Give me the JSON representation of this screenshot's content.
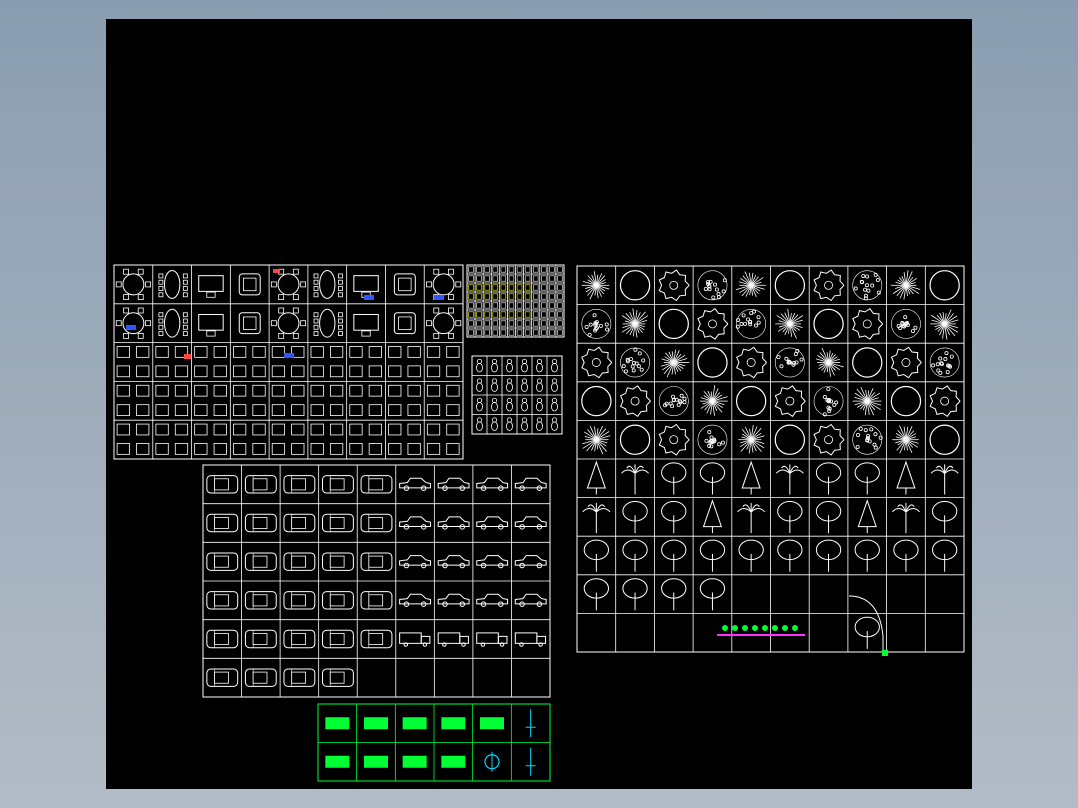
{
  "app": {
    "window_title": "",
    "background_color": "#000000"
  },
  "colors": {
    "line": "#ffffff",
    "accent_green": "#00ff33",
    "accent_yellow": "#ffff00",
    "accent_cyan": "#00d8ff",
    "accent_red": "#ff4444",
    "accent_blue": "#3355ff",
    "accent_magenta": "#ff33ff"
  },
  "sheets": [
    {
      "id": "furniture-sheet",
      "content": "furniture-blocks",
      "cols": 9,
      "rows": 5
    },
    {
      "id": "symbol-sheet-small",
      "content": "small-symbols",
      "cols": 12,
      "rows": 8
    },
    {
      "id": "people-sheet",
      "content": "people-blocks",
      "cols": 6,
      "rows": 4
    },
    {
      "id": "vehicle-sheet",
      "content": "vehicle-blocks",
      "cols": 9,
      "rows": 6
    },
    {
      "id": "sign-sheet",
      "content": "sign-blocks",
      "cols": 6,
      "rows": 2
    },
    {
      "id": "plant-sheet",
      "content": "plant-blocks",
      "cols": 10,
      "rows": 10
    }
  ]
}
